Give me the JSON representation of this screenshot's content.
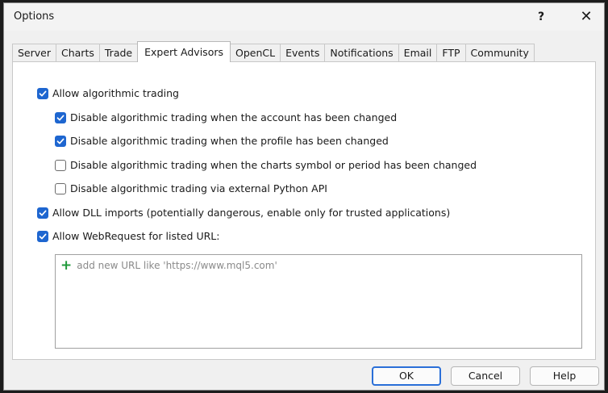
{
  "window": {
    "title": "Options",
    "help_glyph": "?",
    "close_glyph": "✕"
  },
  "tabs": [
    {
      "label": "Server",
      "active": false
    },
    {
      "label": "Charts",
      "active": false
    },
    {
      "label": "Trade",
      "active": false
    },
    {
      "label": "Expert Advisors",
      "active": true
    },
    {
      "label": "OpenCL",
      "active": false
    },
    {
      "label": "Events",
      "active": false
    },
    {
      "label": "Notifications",
      "active": false
    },
    {
      "label": "Email",
      "active": false
    },
    {
      "label": "FTP",
      "active": false
    },
    {
      "label": "Community",
      "active": false
    }
  ],
  "options": {
    "allow_algo": {
      "label": "Allow algorithmic trading",
      "checked": true
    },
    "disable_account": {
      "label": "Disable algorithmic trading when the account has been changed",
      "checked": true
    },
    "disable_profile": {
      "label": "Disable algorithmic trading when the profile has been changed",
      "checked": true
    },
    "disable_symbol": {
      "label": "Disable algorithmic trading when the charts symbol or period has been changed",
      "checked": false
    },
    "disable_python": {
      "label": "Disable algorithmic trading via external Python API",
      "checked": false
    },
    "allow_dll": {
      "label": "Allow DLL imports (potentially dangerous, enable only for trusted applications)",
      "checked": true
    },
    "allow_webrequest": {
      "label": "Allow WebRequest for listed URL:",
      "checked": true
    }
  },
  "url_list": {
    "add_glyph": "+",
    "add_text": "add new URL like 'https://www.mql5.com'"
  },
  "buttons": {
    "ok": "OK",
    "cancel": "Cancel",
    "help": "Help"
  },
  "colors": {
    "checkbox_checked": "#1e66d0",
    "default_button_border": "#2a6fd8",
    "add_plus": "#1f9a3a"
  }
}
